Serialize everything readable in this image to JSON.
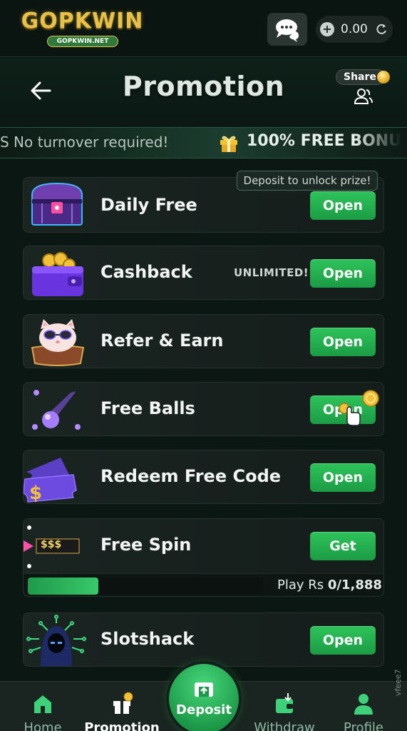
{
  "topbar": {
    "logo_text": "GOPKWIN",
    "logo_subtext": "GOPKWIN.NET",
    "balance": "0.00"
  },
  "header": {
    "title": "Promotion",
    "share_label": "Share"
  },
  "marquee": {
    "left_text": "S  No turnover required!",
    "right_text": "100% FREE BONU"
  },
  "promotions": [
    {
      "name": "Daily Free",
      "action": "Open",
      "icon": "treasure-chest-icon",
      "tooltip": "Deposit to unlock prize!"
    },
    {
      "name": "Cashback",
      "action": "Open",
      "icon": "wallet-coins-icon",
      "tag": "UNLIMITED!"
    },
    {
      "name": "Refer & Earn",
      "action": "Open",
      "icon": "lucky-cat-icon"
    },
    {
      "name": "Free Balls",
      "action": "Open",
      "icon": "purple-ball-icon"
    },
    {
      "name": "Redeem Free Code",
      "action": "Open",
      "icon": "ticket-icon"
    },
    {
      "name": "Free Spin",
      "action": "Get",
      "icon": "slot-spin-icon",
      "spin_badge": "$$$",
      "progress_prefix": "Play Rs",
      "progress_value": "0/1,888",
      "progress_fraction": 0.3
    },
    {
      "name": "Slotshack",
      "action": "Open",
      "icon": "hacker-icon"
    }
  ],
  "bottom_nav": {
    "home": "Home",
    "promotion": "Promotion",
    "deposit": "Deposit",
    "withdraw": "Withdraw",
    "profile": "Profile"
  },
  "watermark": "vfeee7",
  "colors": {
    "accent_green": "#2ec35a",
    "background": "#0b1712",
    "card": "#1a2421",
    "gold": "#e8c14a"
  }
}
